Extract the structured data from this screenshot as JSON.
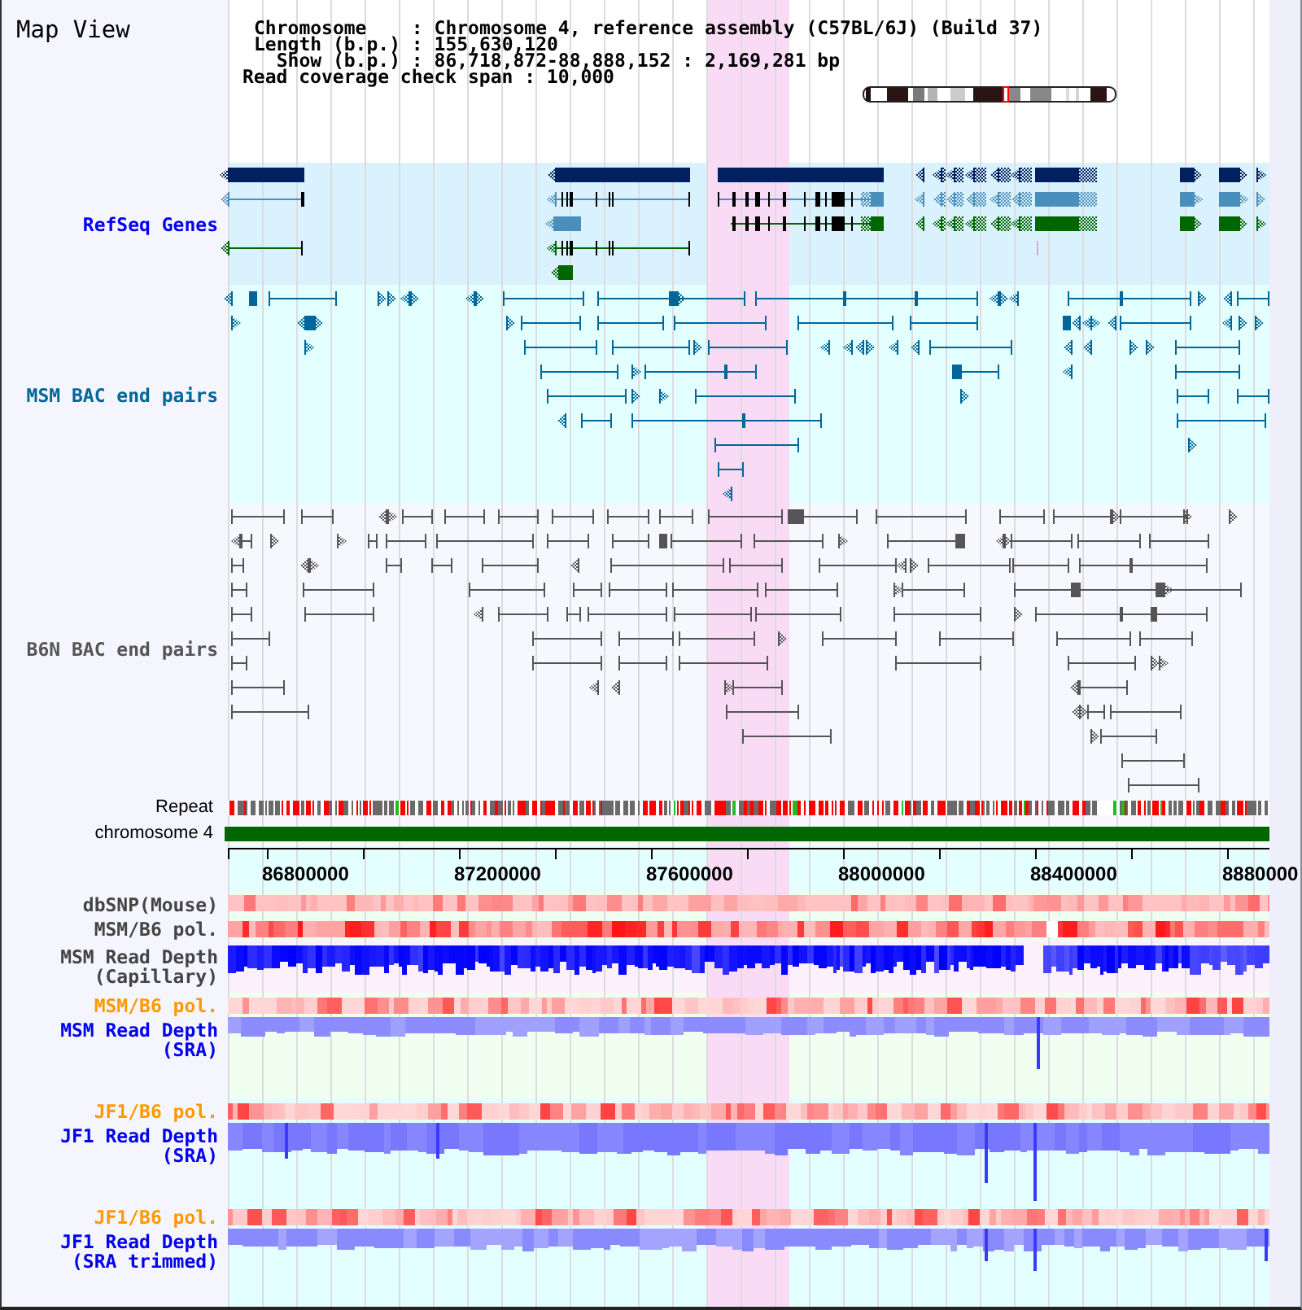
{
  "title": "Map View",
  "summary": {
    "table": [
      "Chromosome    : Chromosome 4, reference assembly (C57BL/6J) (Build 37)",
      "Length (b.p.) : 155,630,120",
      "  Show (b.p.) : 86,718,872-88,888,152 : 2,169,281 bp"
    ],
    "span": "Read coverage check span : 10,000"
  },
  "upper_tracks": [
    {
      "kind": "genes",
      "label": "RefSeq Genes",
      "color": "#0000ee"
    },
    {
      "kind": "pairs",
      "label": "MSM BAC end pairs",
      "color": "#006699"
    },
    {
      "kind": "pairs",
      "label": "B6N BAC end pairs",
      "color": "#555555"
    },
    {
      "kind": "repeats",
      "label": "Repeat",
      "color": "#000000"
    },
    {
      "kind": "chromosome",
      "label": "chromosome 4",
      "color": "#000000"
    }
  ],
  "ruler": {
    "ticks": [
      "86800000",
      "87200000",
      "87600000",
      "88000000",
      "88400000",
      "8880000"
    ]
  },
  "lower_tracks": [
    {
      "kind": "snps",
      "label": "dbSNP(Mouse)",
      "color": "#444444"
    },
    {
      "kind": "polymorphism",
      "label": "MSM/B6 pol.",
      "color": "#444444"
    },
    {
      "kind": "capillary",
      "label": "MSM Read Depth (Capillary)",
      "color": "#444444"
    },
    {
      "kind": "polymorphism",
      "label": "MSM/B6 pol.",
      "color": "#ff9900"
    },
    {
      "kind": "reads",
      "label": "MSM Read Depth (SRA)",
      "color": "#0000ee"
    },
    {
      "kind": "polymorphism",
      "label": "JF1/B6 pol.",
      "color": "#ff9900"
    },
    {
      "kind": "reads",
      "label": "JF1 Read Depth (SRA)",
      "color": "#0000ee"
    },
    {
      "kind": "polymorphism",
      "label": "JF1/B6 pol.",
      "color": "#ff9900"
    },
    {
      "kind": "reads",
      "label": "JF1 Read Depth (SRA trimmed)",
      "color": "#0000ee"
    }
  ]
}
